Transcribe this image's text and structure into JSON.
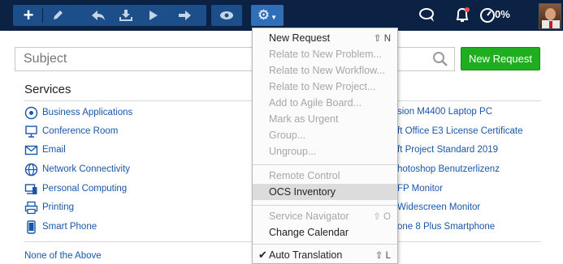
{
  "toolbar": {
    "quick_access_percent": "0%"
  },
  "search": {
    "placeholder": "Subject",
    "new_request_label": "New Request"
  },
  "services": {
    "title": "Services",
    "items": [
      {
        "label": "Business Applications",
        "icon": "business-applications-icon"
      },
      {
        "label": "Conference Room",
        "icon": "conference-room-icon"
      },
      {
        "label": "Email",
        "icon": "email-icon"
      },
      {
        "label": "Network Connectivity",
        "icon": "network-connectivity-icon"
      },
      {
        "label": "Personal Computing",
        "icon": "personal-computing-icon"
      },
      {
        "label": "Printing",
        "icon": "printer-icon"
      },
      {
        "label": "Smart Phone",
        "icon": "smart-phone-icon"
      }
    ],
    "none_of_above": "None of the Above"
  },
  "catalog_items": [
    "sion M4400 Laptop PC",
    "ft Office E3 License Certificate",
    "ft Project Standard 2019",
    "hotoshop Benutzerlizenz",
    "FP Monitor",
    "Widescreen Monitor",
    "one 8 Plus Smartphone"
  ],
  "menu": {
    "items": [
      {
        "label": "New Request",
        "shortcut": "⇧ N",
        "disabled": false
      },
      {
        "label": "Relate to New Problem...",
        "shortcut": "",
        "disabled": true
      },
      {
        "label": "Relate to New Workflow...",
        "shortcut": "",
        "disabled": true
      },
      {
        "label": "Relate to New Project...",
        "shortcut": "",
        "disabled": true
      },
      {
        "label": "Add to Agile Board...",
        "shortcut": "",
        "disabled": true
      },
      {
        "label": "Mark as Urgent",
        "shortcut": "",
        "disabled": true
      },
      {
        "label": "Group...",
        "shortcut": "",
        "disabled": true
      },
      {
        "label": "Ungroup...",
        "shortcut": "",
        "disabled": true
      },
      {
        "label": "Remote Control",
        "shortcut": "",
        "disabled": true
      },
      {
        "label": "OCS Inventory",
        "shortcut": "",
        "disabled": false,
        "highlighted": true
      },
      {
        "label": "Service Navigator",
        "shortcut": "⇧ O",
        "disabled": true
      },
      {
        "label": "Change Calendar",
        "shortcut": "",
        "disabled": false
      },
      {
        "label": "Auto Translation",
        "shortcut": "⇧ L",
        "disabled": false,
        "checked": true
      }
    ]
  },
  "colors": {
    "toolbar_bg": "#0b2244",
    "accent_blue": "#2f6eb8",
    "new_request_green": "#1fae1f",
    "link_blue": "#1a56a8"
  }
}
